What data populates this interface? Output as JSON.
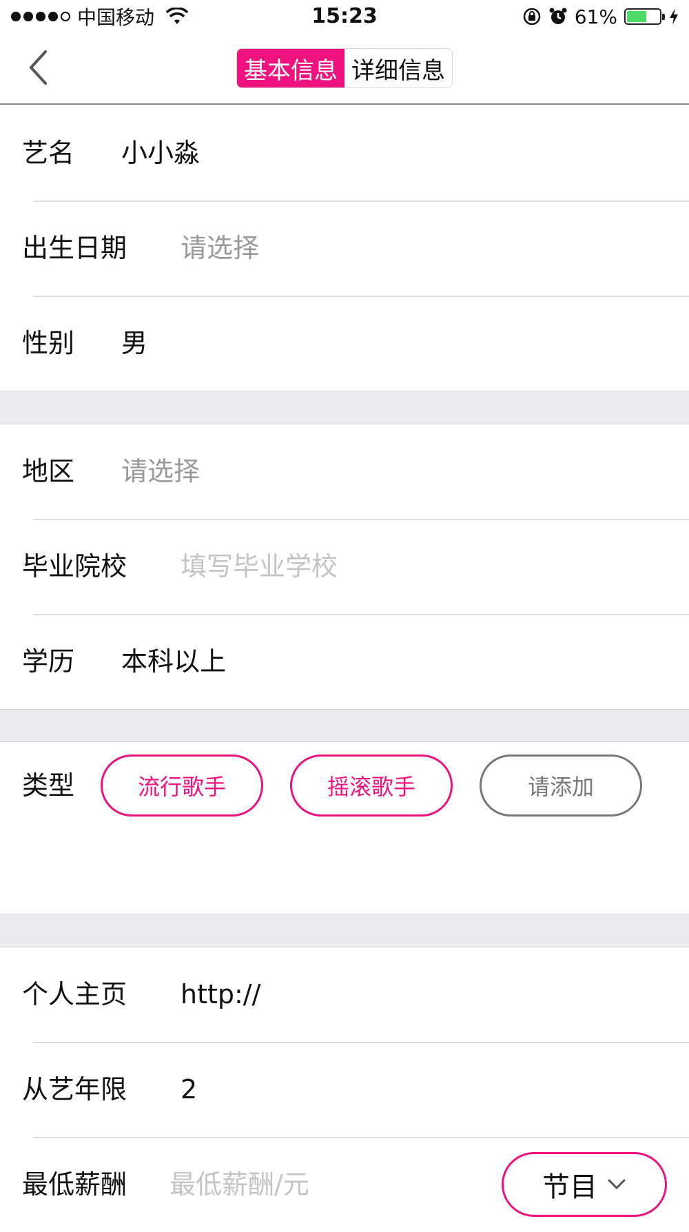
{
  "status_bar": {
    "carrier": "中国移动",
    "time": "15:23",
    "battery_percent": "61%",
    "battery_level": 0.61,
    "battery_color": "#4cd964"
  },
  "nav": {
    "back_icon": "chevron-left-icon",
    "tabs": [
      {
        "label": "基本信息",
        "active": true
      },
      {
        "label": "详细信息",
        "active": false
      }
    ],
    "accent_color": "#ee127e"
  },
  "form": {
    "stage_name": {
      "label": "艺名",
      "value": "小小淼"
    },
    "birth_date": {
      "label": "出生日期",
      "placeholder": "请选择"
    },
    "gender": {
      "label": "性别",
      "value": "男"
    },
    "region": {
      "label": "地区",
      "placeholder": "请选择"
    },
    "school": {
      "label": "毕业院校",
      "placeholder": "填写毕业学校"
    },
    "education": {
      "label": "学历",
      "value": "本科以上"
    },
    "type": {
      "label": "类型",
      "tags": [
        "流行歌手",
        "摇滚歌手"
      ],
      "add_label": "请添加"
    },
    "homepage": {
      "label": "个人主页",
      "value": "http://"
    },
    "years": {
      "label": "从艺年限",
      "value": "2"
    },
    "min_salary": {
      "label": "最低薪酬",
      "placeholder": "最低薪酬/元"
    }
  },
  "salary_unit_selector": {
    "value": "节目",
    "icon": "chevron-down-icon"
  }
}
